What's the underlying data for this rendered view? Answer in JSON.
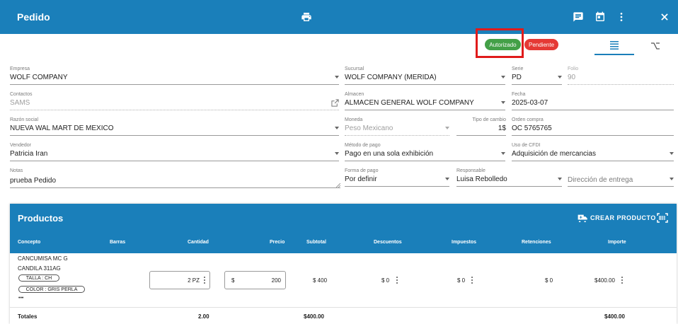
{
  "appbar": {
    "title": "Pedido",
    "icons": [
      "printer-icon",
      "comment-icon",
      "calendar-icon",
      "more-vert-icon",
      "close-icon"
    ]
  },
  "status": {
    "authorized": "Autorizado",
    "pending": "Pendiente",
    "colors": {
      "authorized": "#43a047",
      "pending": "#e53935",
      "highlight": "#e01b1b"
    }
  },
  "view_tabs": [
    "list-lines-icon",
    "branch-icon"
  ],
  "form": {
    "empresa": {
      "label": "Empresa",
      "value": "WOLF COMPANY"
    },
    "sucursal": {
      "label": "Sucursal",
      "value": "WOLF COMPANY (MERIDA)"
    },
    "serie": {
      "label": "Serie",
      "value": "PD"
    },
    "folio": {
      "label": "Folio",
      "value": "90"
    },
    "contactos": {
      "label": "Contactos",
      "value": "SAMS"
    },
    "almacen": {
      "label": "Almacen",
      "value": "ALMACEN GENERAL WOLF COMPANY"
    },
    "fecha": {
      "label": "Fecha",
      "value": "2025-03-07"
    },
    "razon_social": {
      "label": "Razón social",
      "value": "NUEVA WAL MART DE MEXICO"
    },
    "moneda": {
      "label": "Moneda",
      "value": "Peso Mexicano"
    },
    "tipo_cambio": {
      "label": "Tipo de cambio",
      "value": "1$"
    },
    "orden_compra": {
      "label": "Orden compra",
      "value": "OC 5765765"
    },
    "vendedor": {
      "label": "Vendedor",
      "value": "Patricia Iran"
    },
    "metodo_pago": {
      "label": "Método de pago",
      "value": "Pago en una sola exhibición"
    },
    "uso_cfdi": {
      "label": "Uso de CFDI",
      "value": "Adquisición de mercancias"
    },
    "notas": {
      "label": "Notas",
      "value": "prueba Pedido"
    },
    "forma_pago": {
      "label": "Forma de pago",
      "value": "Por definir"
    },
    "responsable": {
      "label": "Responsable",
      "value": "Luisa Rebolledo"
    },
    "direccion_entrega": {
      "placeholder": "Dirección de entrega"
    }
  },
  "productos": {
    "title": "Productos",
    "crear_label": "CREAR PRODUCTO",
    "headers": [
      "Concepto",
      "Barras",
      "Cantidad",
      "Precio",
      "Subtotal",
      "Descuentos",
      "Impuestos",
      "Retenciones",
      "Importe"
    ],
    "row": {
      "concepto_line1": "CANCUMISA MC G",
      "concepto_line2": "CANDILA 311AG",
      "tag_talla": "TALLA : CH",
      "tag_color": "COLOR : GRIS PERLA",
      "more": "•••",
      "cantidad": "2 PZ",
      "precio_prefix": "$",
      "precio": "200",
      "subtotal": "$ 400",
      "descuentos": "$ 0",
      "impuestos": "$ 0",
      "retenciones": "$ 0",
      "importe": "$400.00"
    },
    "totales": {
      "label": "Totales",
      "cantidad": "2.00",
      "subtotal": "$400.00",
      "importe": "$400.00"
    }
  }
}
